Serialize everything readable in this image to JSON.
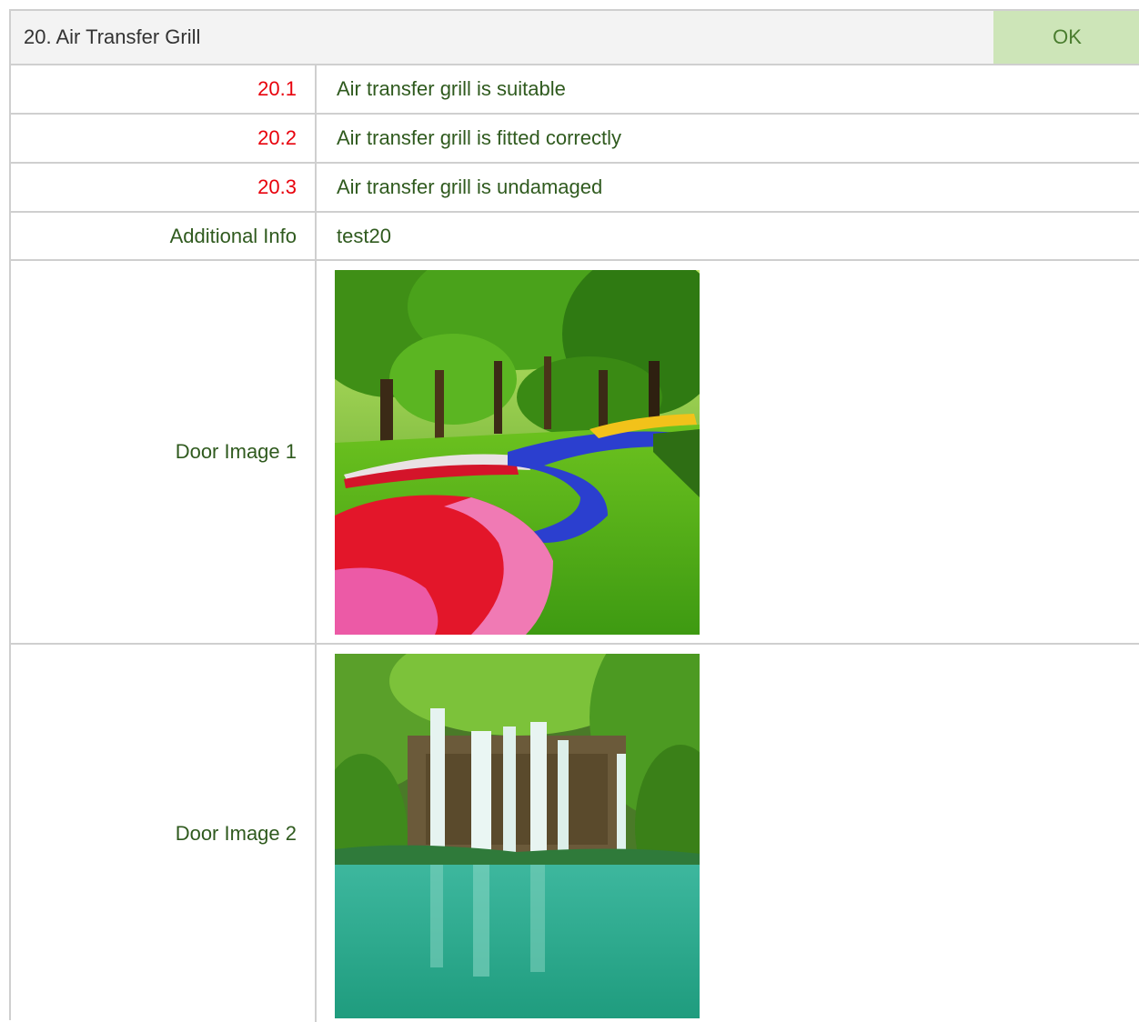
{
  "section": {
    "title": "20. Air Transfer Grill",
    "status": "OK",
    "status_bg": "#cde5b8",
    "status_color": "#4a7d2f"
  },
  "checks": [
    {
      "number": "20.1",
      "text": "Air transfer grill is suitable"
    },
    {
      "number": "20.2",
      "text": "Air transfer grill is fitted correctly"
    },
    {
      "number": "20.3",
      "text": "Air transfer grill is undamaged"
    }
  ],
  "additional_info": {
    "label": "Additional Info",
    "value": "test20"
  },
  "images": [
    {
      "label": "Door Image 1",
      "subject": "flower-garden-photo"
    },
    {
      "label": "Door Image 2",
      "subject": "waterfall-lagoon-photo"
    }
  ],
  "colors": {
    "number_red": "#e8000b",
    "label_green": "#2f5a1e",
    "border": "#cfcfcf"
  }
}
